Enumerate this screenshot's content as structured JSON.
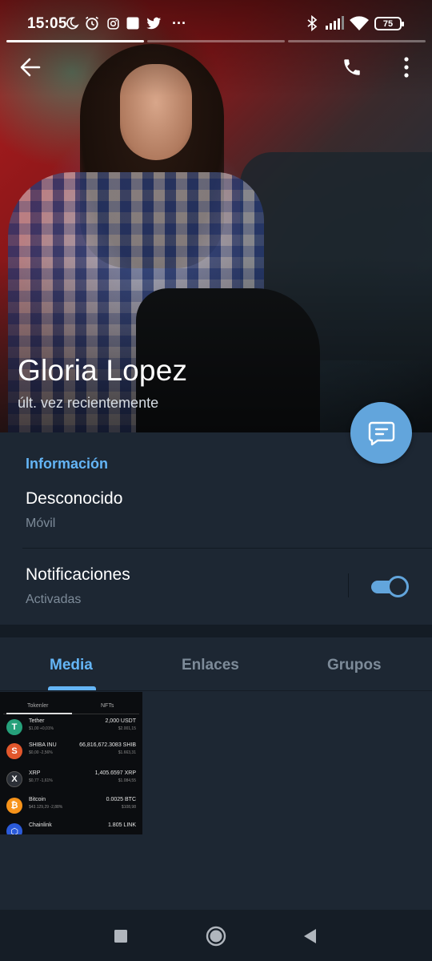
{
  "status_bar": {
    "time": "15:05",
    "battery": "75",
    "more_dots": "···",
    "icons": [
      "moon-icon",
      "alarm-icon",
      "instagram-icon",
      "app-square-icon",
      "twitter-icon",
      "bluetooth-icon",
      "signal-icon",
      "wifi-icon",
      "battery-icon"
    ]
  },
  "profile": {
    "name": "Gloria Lopez",
    "last_seen": "últ. vez recientemente"
  },
  "header": {
    "back_icon": "back-arrow-icon",
    "call_icon": "phone-icon",
    "menu_icon": "more-vertical-icon"
  },
  "info": {
    "title": "Información",
    "phone_value": "Desconocido",
    "phone_label": "Móvil",
    "notifications_label": "Notificaciones",
    "notifications_status": "Activadas",
    "notifications_enabled": true
  },
  "tabs": [
    {
      "label": "Media",
      "active": true
    },
    {
      "label": "Enlaces",
      "active": false
    },
    {
      "label": "Grupos",
      "active": false
    }
  ],
  "media_thumb": {
    "tab_tokens": "Tokenler",
    "tab_nfts": "NFTs",
    "rows": [
      {
        "name": "Tether",
        "sub": "$1,00 +0,01%",
        "amount": "2,000 USDT",
        "value": "$2.001,15",
        "symbol": "T",
        "color": "#26a17b"
      },
      {
        "name": "SHIBA INU",
        "sub": "$0,00 -2,56%",
        "amount": "66,816,672.3083 SHIB",
        "value": "$1.663,31",
        "symbol": "S",
        "color": "#e2572c"
      },
      {
        "name": "XRP",
        "sub": "$0,77 -1,61%",
        "amount": "1,405.6597 XRP",
        "value": "$1.084,55",
        "symbol": "X",
        "color": "#2b2f36"
      },
      {
        "name": "Bitcoin",
        "sub": "$43.129,29 -2,88%",
        "amount": "0.0025 BTC",
        "value": "$108,98",
        "symbol": "₿",
        "color": "#f7931a"
      },
      {
        "name": "Chainlink",
        "sub": "",
        "amount": "1.805 LINK",
        "value": "",
        "symbol": "⬡",
        "color": "#2a5ada"
      }
    ]
  },
  "colors": {
    "accent": "#64b5f6",
    "fab": "#62a5dc",
    "background": "#1d2733",
    "secondary_text": "#7d8b99"
  },
  "nav_bar": {
    "recent_icon": "square-recents-icon",
    "home_icon": "circle-home-icon",
    "back_icon": "triangle-back-icon"
  }
}
